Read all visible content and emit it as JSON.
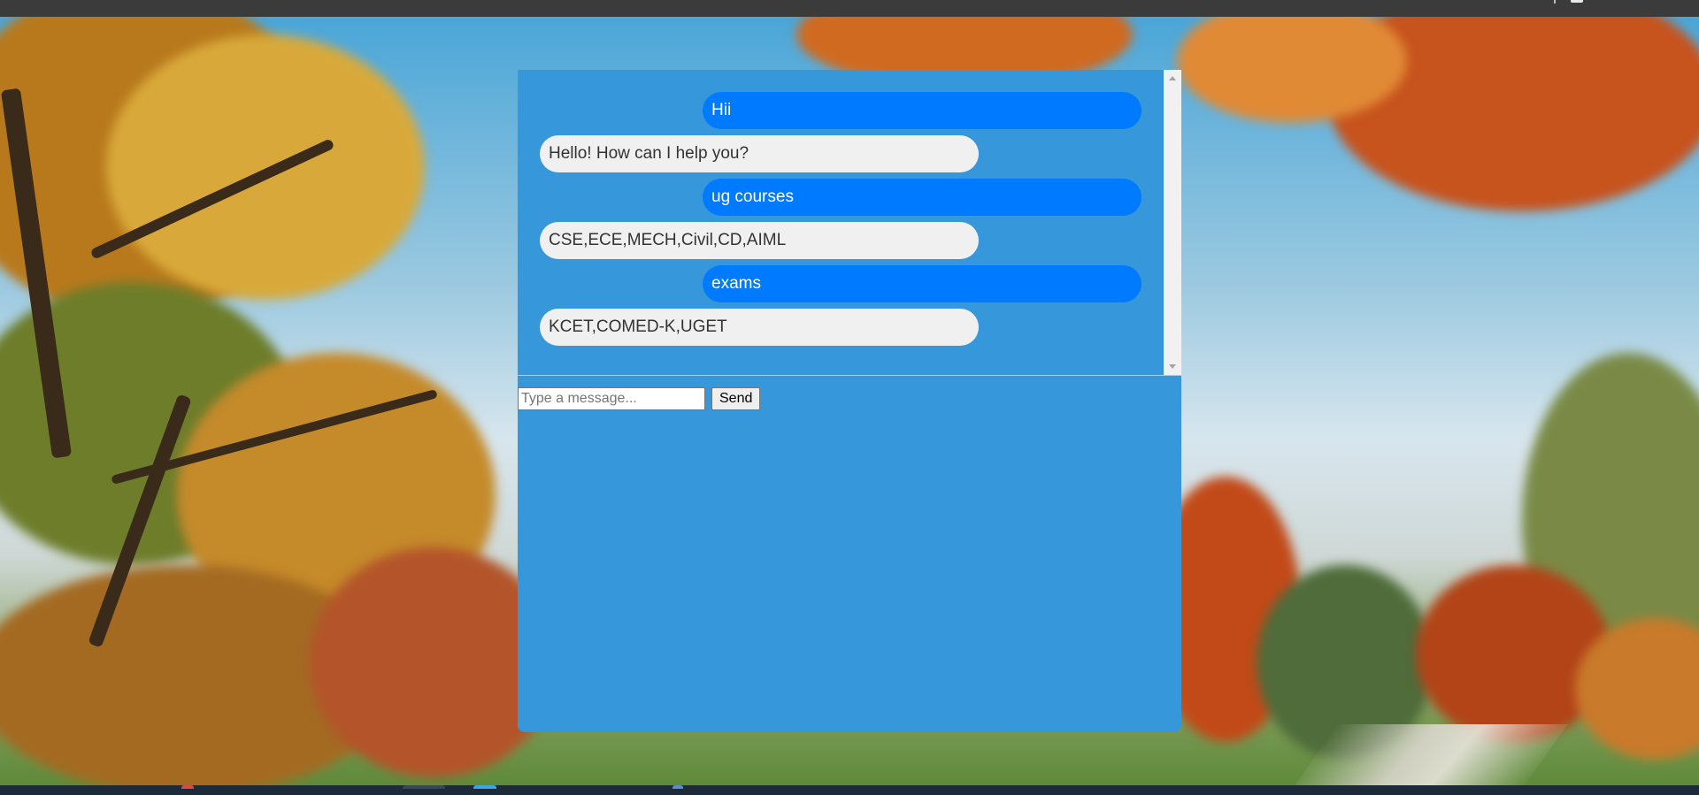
{
  "chat": {
    "messages": [
      {
        "sender": "user",
        "text": "Hii"
      },
      {
        "sender": "bot",
        "text": "Hello! How can I help you?"
      },
      {
        "sender": "user",
        "text": "ug courses"
      },
      {
        "sender": "bot",
        "text": "CSE,ECE,MECH,Civil,CD,AIML"
      },
      {
        "sender": "user",
        "text": "exams"
      },
      {
        "sender": "bot",
        "text": "KCET,COMED-K,UGET"
      }
    ],
    "input_placeholder": "Type a message...",
    "input_value": "",
    "send_label": "Send"
  },
  "colors": {
    "panel": "#3797db",
    "user_bubble": "#007bff",
    "bot_bubble": "#f0f0f0"
  },
  "icons": {
    "scroll_up": "scroll-up-arrow-icon",
    "scroll_down": "scroll-down-arrow-icon"
  }
}
